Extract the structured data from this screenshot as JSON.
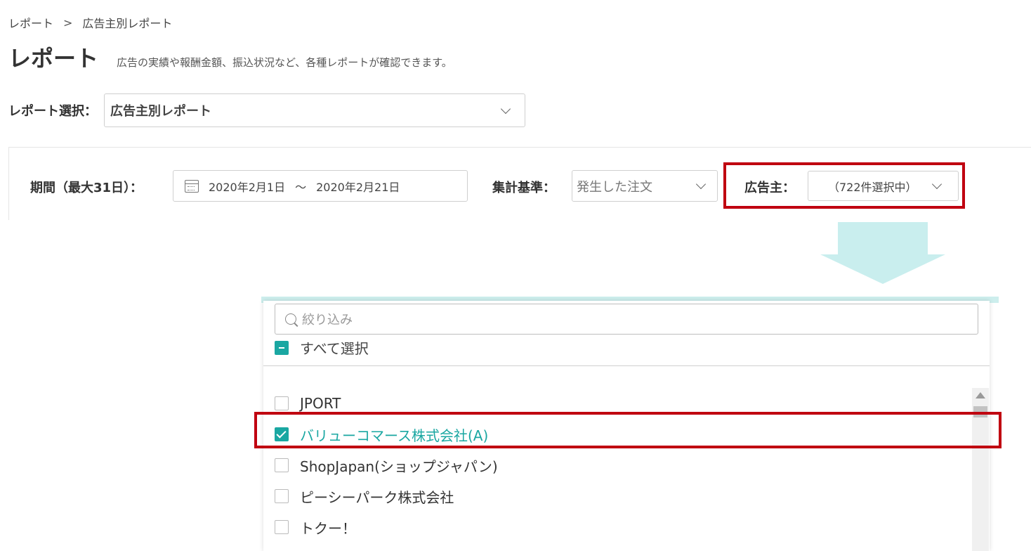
{
  "breadcrumb": {
    "items": [
      "レポート",
      "広告主別レポート"
    ],
    "separator": ">"
  },
  "header": {
    "title": "レポート",
    "description": "広告の実績や報酬金額、振込状況など、各種レポートが確認できます。"
  },
  "report_select": {
    "label": "レポート選択：",
    "value": "広告主別レポート"
  },
  "filters": {
    "period": {
      "label": "期間（最大31日）：",
      "start": "2020年2月1日",
      "tilde": "〜",
      "end": "2020年2月21日"
    },
    "basis": {
      "label": "集計基準：",
      "value": "発生した注文"
    },
    "advertiser": {
      "label": "広告主：",
      "value": "（722件選択中）"
    }
  },
  "dropdown": {
    "search_placeholder": "絞り込み",
    "select_all_label": "すべて選択",
    "items": [
      {
        "label": "JPORT",
        "checked": false
      },
      {
        "label": "バリューコマース株式会社(A)",
        "checked": true
      },
      {
        "label": "ShopJapan(ショップジャパン)",
        "checked": false
      },
      {
        "label": "ピーシーパーク株式会社",
        "checked": false
      },
      {
        "label": "トクー！",
        "checked": false
      }
    ]
  },
  "colors": {
    "accent": "#1aa7a2",
    "highlight": "#c00010",
    "arrow": "#c9eeee"
  }
}
